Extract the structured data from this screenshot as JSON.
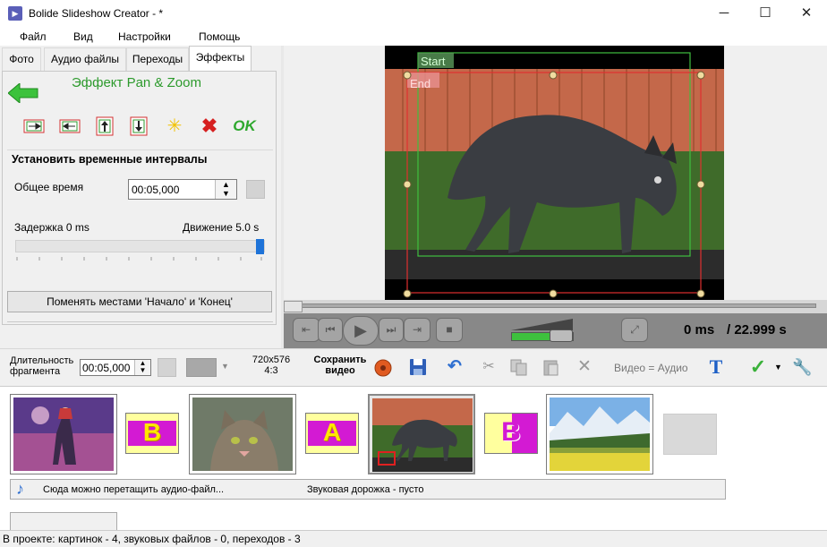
{
  "window": {
    "title": "Bolide Slideshow Creator - *",
    "minimize": "─",
    "maximize": "☐",
    "close": "✕"
  },
  "menu": [
    "Файл",
    "Вид",
    "Настройки",
    "Помощь"
  ],
  "tabs": [
    "Фото",
    "Аудио файлы",
    "Переходы",
    "Эффекты"
  ],
  "effects": {
    "title": "Эффект Pan & Zoom",
    "ok_label": "OK",
    "section_title": "Установить временные интервалы",
    "total_time_label": "Общее время",
    "total_time_value": "00:05,000",
    "delay_label": "Задержка 0 ms",
    "motion_label": "Движение 5.0 s",
    "swap_button": "Поменять местами 'Начало' и 'Конец'"
  },
  "preview": {
    "start_label": "Start",
    "end_label": "End"
  },
  "player": {
    "current_time": "0 ms",
    "total_time": "/ 22.999 s"
  },
  "toolbar": {
    "duration_label_line1": "Длительность",
    "duration_label_line2": "фрагмента",
    "duration_value": "00:05,000",
    "resolution_line1": "720x576",
    "resolution_line2": "4:3",
    "save_video_line1": "Сохранить",
    "save_video_line2": "видео",
    "video_equals_audio": "Видео = Аудио"
  },
  "timeline": {
    "transitions": [
      "B",
      "A",
      "B"
    ],
    "audio_hint": "Сюда можно перетащить аудио-файл...",
    "audio_track_status": "Звуковая дорожка - пусто"
  },
  "status": {
    "text": "В проекте: картинок - 4, звуковых файлов - 0, переходов - 3"
  },
  "icons": [
    "app-icon",
    "back-arrow-icon",
    "move-right-icon",
    "move-left-icon",
    "move-up-icon",
    "move-down-icon",
    "star-icon",
    "delete-icon",
    "play-icon",
    "record-icon",
    "save-icon",
    "undo-icon",
    "cut-icon",
    "copy-icon",
    "paste-icon",
    "text-icon",
    "check-icon",
    "wrench-icon",
    "music-note-icon"
  ],
  "colors": {
    "accent_green": "#2c9a2c",
    "start_rect": "#3fbf3f",
    "end_rect": "#e03030",
    "slider_thumb": "#1e73d8",
    "transition_bg": "#ffff9e",
    "transition_letter": "#d31ad3"
  }
}
